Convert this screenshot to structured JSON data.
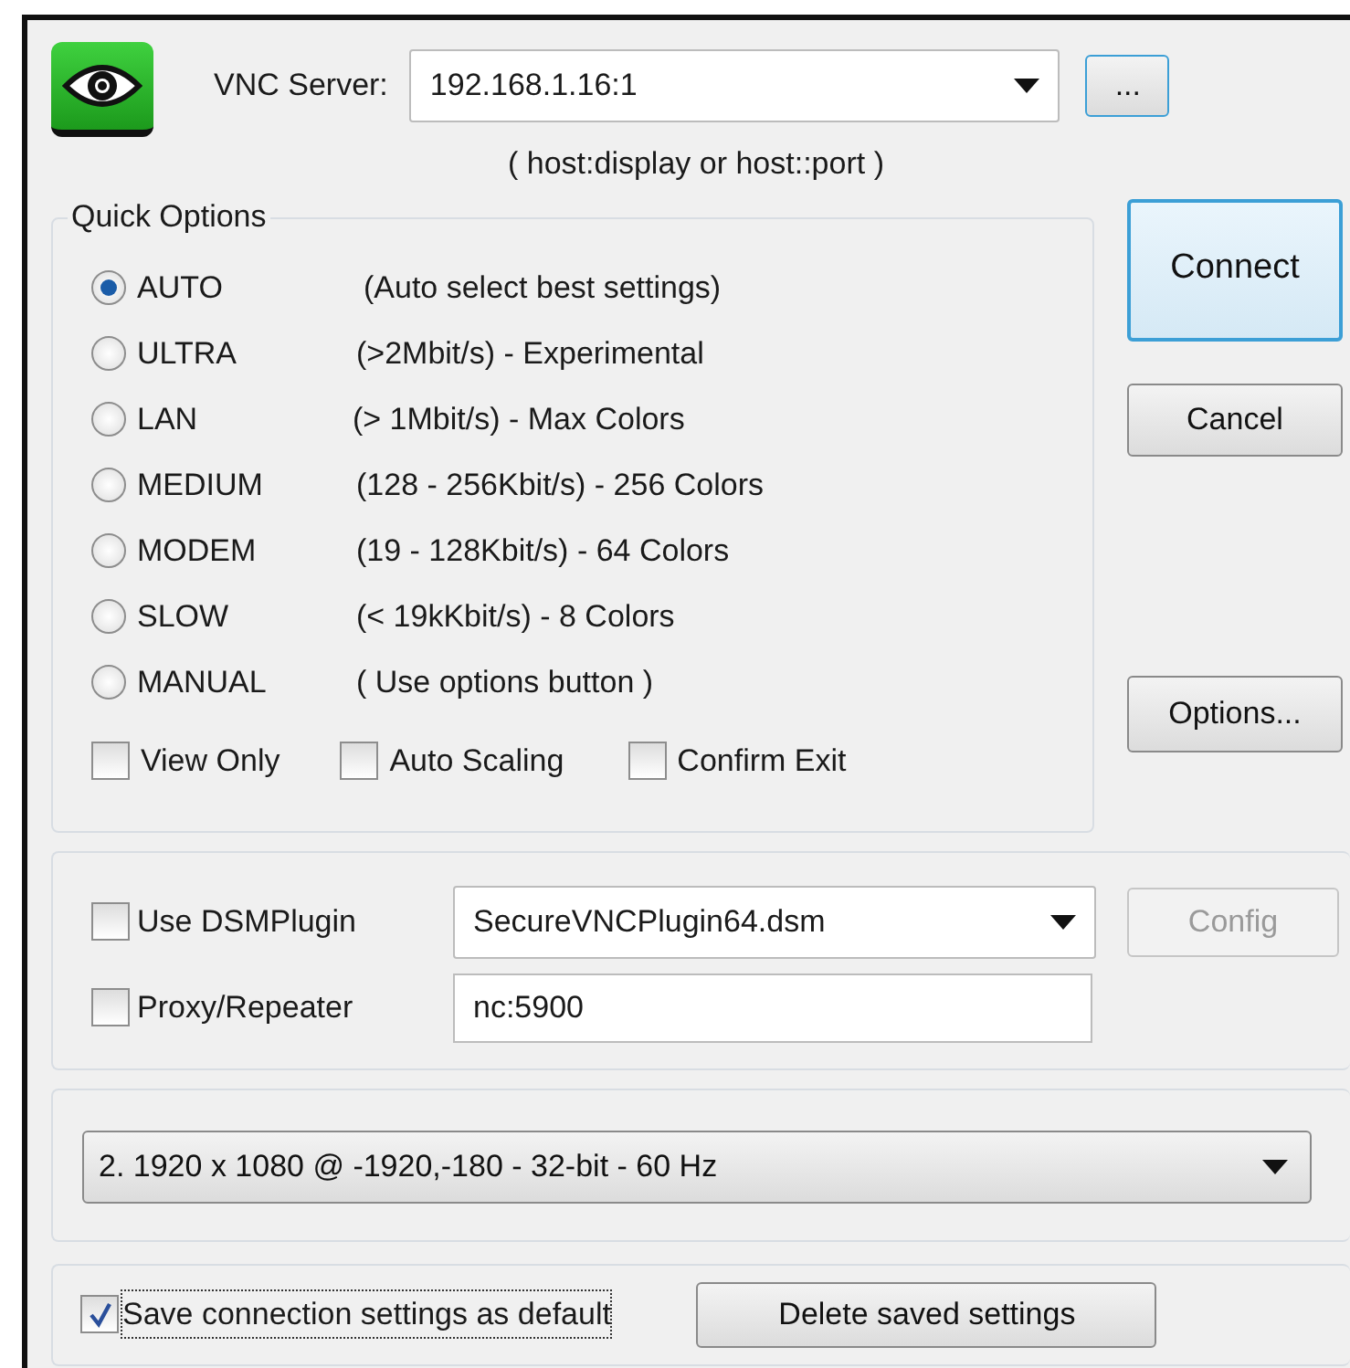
{
  "server": {
    "label": "VNC Server:",
    "value": "192.168.1.16:1",
    "hint": "( host:display or host::port )"
  },
  "browse_button": "...",
  "quick_options": {
    "title": "Quick Options",
    "radios": [
      {
        "label": "AUTO",
        "description": "(Auto select best settings)",
        "selected": true
      },
      {
        "label": "ULTRA",
        "description": "(>2Mbit/s) - Experimental",
        "selected": false
      },
      {
        "label": "LAN",
        "description": "(> 1Mbit/s) - Max Colors",
        "selected": false
      },
      {
        "label": "MEDIUM",
        "description": "(128 - 256Kbit/s) - 256 Colors",
        "selected": false
      },
      {
        "label": "MODEM",
        "description": "(19 - 128Kbit/s) - 64 Colors",
        "selected": false
      },
      {
        "label": "SLOW",
        "description": "(< 19kKbit/s) - 8 Colors",
        "selected": false
      },
      {
        "label": "MANUAL",
        "description": "( Use options button )",
        "selected": false
      }
    ],
    "checkboxes": [
      {
        "label": "View Only",
        "checked": false
      },
      {
        "label": "Auto Scaling",
        "checked": false
      },
      {
        "label": "Confirm Exit",
        "checked": false
      }
    ]
  },
  "buttons": [
    {
      "label": "Connect",
      "default": true
    },
    {
      "label": "Cancel",
      "default": false
    },
    {
      "label": "Options...",
      "default": false
    }
  ],
  "plugin": {
    "label": "Use DSMPlugin",
    "checked": false,
    "value": "SecureVNCPlugin64.dsm",
    "config": {
      "label": "Config",
      "disabled": true
    }
  },
  "proxy": {
    "label": "Proxy/Repeater",
    "checked": false,
    "value": "nc:5900"
  },
  "monitor": {
    "value": "2. 1920 x 1080 @ -1920,-180 - 32-bit - 60 Hz"
  },
  "save_default": {
    "label": "Save connection settings as default",
    "checked": true
  },
  "delete_button": "Delete saved settings"
}
